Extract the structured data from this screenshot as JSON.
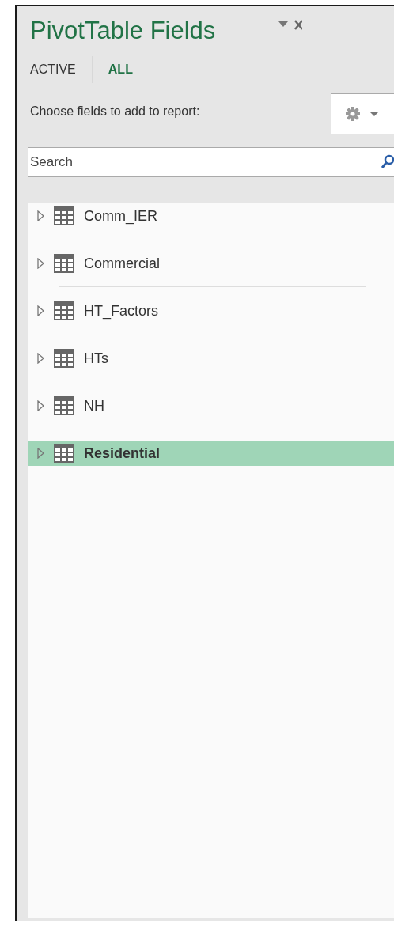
{
  "panel": {
    "title": "PivotTable Fields"
  },
  "tabs": [
    {
      "label": "ACTIVE",
      "selected": false
    },
    {
      "label": "ALL",
      "selected": true
    }
  ],
  "prompt": "Choose fields to add to report:",
  "search": {
    "placeholder": "Search"
  },
  "tables": [
    {
      "name": "Comm_IER",
      "selected": false,
      "rule_below": false
    },
    {
      "name": "Commercial",
      "selected": false,
      "rule_below": true
    },
    {
      "name": "HT_Factors",
      "selected": false,
      "rule_below": false
    },
    {
      "name": "HTs",
      "selected": false,
      "rule_below": false
    },
    {
      "name": "NH",
      "selected": false,
      "rule_below": false
    },
    {
      "name": "Residential",
      "selected": true,
      "rule_below": false
    }
  ]
}
